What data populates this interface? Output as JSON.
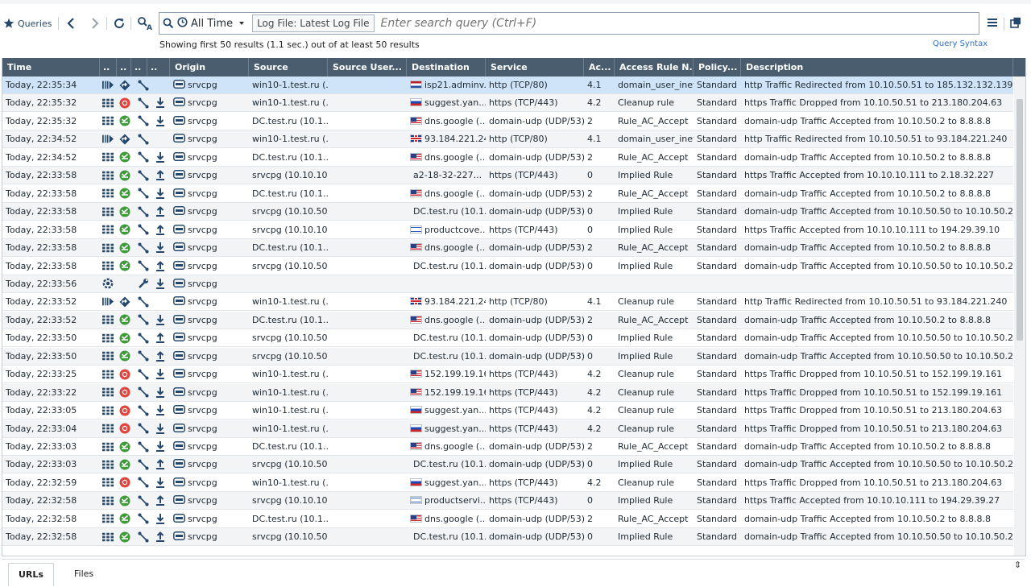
{
  "toolbar": {
    "queries_label": "Queries",
    "time_filter": "All Time",
    "log_file_chip": "Log File: Latest Log File",
    "search_placeholder": "Enter search query (Ctrl+F)"
  },
  "status": {
    "summary": "Showing first 50 results (1.1 sec.) out of at least 50 results",
    "query_syntax_link": "Query Syntax"
  },
  "columns": [
    "Time",
    "..",
    "..",
    "..",
    "..",
    "Origin",
    "Source",
    "Source User...",
    "Destination",
    "Service",
    "Ac...",
    "Access Rule N...",
    "Policy...",
    "Description"
  ],
  "rows": [
    {
      "time": "Today, 22:35:34",
      "icons": [
        "vendor",
        "redirect",
        "conn",
        ""
      ],
      "origin": "srvcpg",
      "source": "win10-1.test.ru (...",
      "dest_flag": "nl",
      "destination": "isp21.adminv...",
      "service": "http (TCP/80)",
      "ac": "4.1",
      "rule": "domain_user_inet",
      "policy": "Standard",
      "description": "http Traffic Redirected from 10.10.50.51 to 185.132.132.139"
    },
    {
      "time": "Today, 22:35:32",
      "icons": [
        "grid",
        "drop",
        "conn",
        "down"
      ],
      "origin": "srvcpg",
      "source": "win10-1.test.ru (...",
      "dest_flag": "ru",
      "destination": "suggest.yan...",
      "service": "https (TCP/443)",
      "ac": "4.2",
      "rule": "Cleanup rule",
      "policy": "Standard",
      "description": "https Traffic Dropped from 10.10.50.51 to 213.180.204.63"
    },
    {
      "time": "Today, 22:35:32",
      "icons": [
        "grid",
        "accept",
        "conn",
        "down"
      ],
      "origin": "srvcpg",
      "source": "DC.test.ru (10.1...",
      "dest_flag": "us",
      "destination": "dns.google (...",
      "service": "domain-udp (UDP/53)",
      "ac": "2",
      "rule": "Rule_AC_Accept",
      "policy": "Standard",
      "description": "domain-udp Traffic Accepted from 10.10.50.2 to 8.8.8.8"
    },
    {
      "time": "Today, 22:34:52",
      "icons": [
        "vendor",
        "redirect",
        "conn",
        ""
      ],
      "origin": "srvcpg",
      "source": "win10-1.test.ru (...",
      "dest_flag": "gb",
      "destination": "93.184.221.240",
      "service": "http (TCP/80)",
      "ac": "4.1",
      "rule": "domain_user_inet",
      "policy": "Standard",
      "description": "http Traffic Redirected from 10.10.50.51 to 93.184.221.240"
    },
    {
      "time": "Today, 22:34:52",
      "icons": [
        "grid",
        "accept",
        "conn",
        "down"
      ],
      "origin": "srvcpg",
      "source": "DC.test.ru (10.1...",
      "dest_flag": "us",
      "destination": "dns.google (...",
      "service": "domain-udp (UDP/53)",
      "ac": "2",
      "rule": "Rule_AC_Accept",
      "policy": "Standard",
      "description": "domain-udp Traffic Accepted from 10.10.50.2 to 8.8.8.8"
    },
    {
      "time": "Today, 22:33:58",
      "icons": [
        "grid",
        "accept",
        "conn",
        "up"
      ],
      "origin": "srvcpg",
      "source": "srvcpg (10.10.10....",
      "dest_flag": "",
      "destination": "a2-18-32-227...",
      "service": "https (TCP/443)",
      "ac": "0",
      "rule": "Implied Rule",
      "policy": "Standard",
      "description": "https Traffic Accepted from 10.10.10.111 to 2.18.32.227"
    },
    {
      "time": "Today, 22:33:58",
      "icons": [
        "grid",
        "accept",
        "conn",
        "down"
      ],
      "origin": "srvcpg",
      "source": "DC.test.ru (10.1...",
      "dest_flag": "us",
      "destination": "dns.google (...",
      "service": "domain-udp (UDP/53)",
      "ac": "2",
      "rule": "Rule_AC_Accept",
      "policy": "Standard",
      "description": "domain-udp Traffic Accepted from 10.10.50.2 to 8.8.8.8"
    },
    {
      "time": "Today, 22:33:58",
      "icons": [
        "grid",
        "accept",
        "conn",
        "up"
      ],
      "origin": "srvcpg",
      "source": "srvcpg (10.10.50....",
      "dest_flag": "",
      "destination": "DC.test.ru (10.1...",
      "service": "domain-udp (UDP/53)",
      "ac": "0",
      "rule": "Implied Rule",
      "policy": "Standard",
      "description": "domain-udp Traffic Accepted from 10.10.50.50 to 10.10.50.2"
    },
    {
      "time": "Today, 22:33:58",
      "icons": [
        "grid",
        "accept",
        "conn",
        "up"
      ],
      "origin": "srvcpg",
      "source": "srvcpg (10.10.10....",
      "dest_flag": "il",
      "destination": "productcove...",
      "service": "https (TCP/443)",
      "ac": "0",
      "rule": "Implied Rule",
      "policy": "Standard",
      "description": "https Traffic Accepted from 10.10.10.111 to 194.29.39.10"
    },
    {
      "time": "Today, 22:33:58",
      "icons": [
        "grid",
        "accept",
        "conn",
        "down"
      ],
      "origin": "srvcpg",
      "source": "DC.test.ru (10.1...",
      "dest_flag": "us",
      "destination": "dns.google (...",
      "service": "domain-udp (UDP/53)",
      "ac": "2",
      "rule": "Rule_AC_Accept",
      "policy": "Standard",
      "description": "domain-udp Traffic Accepted from 10.10.50.2 to 8.8.8.8"
    },
    {
      "time": "Today, 22:33:58",
      "icons": [
        "grid",
        "accept",
        "conn",
        "up"
      ],
      "origin": "srvcpg",
      "source": "srvcpg (10.10.50....",
      "dest_flag": "",
      "destination": "DC.test.ru (10.1...",
      "service": "domain-udp (UDP/53)",
      "ac": "0",
      "rule": "Implied Rule",
      "policy": "Standard",
      "description": "domain-udp Traffic Accepted from 10.10.50.50 to 10.10.50.2"
    },
    {
      "time": "Today, 22:33:56",
      "icons": [
        "gear",
        "",
        "wrench",
        "down"
      ],
      "origin": "srvcpg",
      "source": "",
      "dest_flag": "",
      "destination": "",
      "service": "",
      "ac": "",
      "rule": "",
      "policy": "",
      "description": ""
    },
    {
      "time": "Today, 22:33:52",
      "icons": [
        "vendor",
        "redirect",
        "conn",
        ""
      ],
      "origin": "srvcpg",
      "source": "win10-1.test.ru (...",
      "dest_flag": "gb",
      "destination": "93.184.221.240",
      "service": "http (TCP/80)",
      "ac": "4.1",
      "rule": "Cleanup rule",
      "policy": "Standard",
      "description": "http Traffic Redirected from 10.10.50.51 to 93.184.221.240"
    },
    {
      "time": "Today, 22:33:52",
      "icons": [
        "grid",
        "accept",
        "conn",
        "down"
      ],
      "origin": "srvcpg",
      "source": "DC.test.ru (10.1...",
      "dest_flag": "us",
      "destination": "dns.google (...",
      "service": "domain-udp (UDP/53)",
      "ac": "2",
      "rule": "Rule_AC_Accept",
      "policy": "Standard",
      "description": "domain-udp Traffic Accepted from 10.10.50.2 to 8.8.8.8"
    },
    {
      "time": "Today, 22:33:50",
      "icons": [
        "grid",
        "accept",
        "conn",
        "up"
      ],
      "origin": "srvcpg",
      "source": "srvcpg (10.10.50....",
      "dest_flag": "",
      "destination": "DC.test.ru (10.1...",
      "service": "domain-udp (UDP/53)",
      "ac": "0",
      "rule": "Implied Rule",
      "policy": "Standard",
      "description": "domain-udp Traffic Accepted from 10.10.50.50 to 10.10.50.2"
    },
    {
      "time": "Today, 22:33:50",
      "icons": [
        "grid",
        "accept",
        "conn",
        "up"
      ],
      "origin": "srvcpg",
      "source": "srvcpg (10.10.50....",
      "dest_flag": "",
      "destination": "DC.test.ru (10.1...",
      "service": "domain-udp (UDP/53)",
      "ac": "0",
      "rule": "Implied Rule",
      "policy": "Standard",
      "description": "domain-udp Traffic Accepted from 10.10.50.50 to 10.10.50.2"
    },
    {
      "time": "Today, 22:33:25",
      "icons": [
        "grid",
        "drop",
        "conn",
        "down"
      ],
      "origin": "srvcpg",
      "source": "win10-1.test.ru (...",
      "dest_flag": "us",
      "destination": "152.199.19.161",
      "service": "https (TCP/443)",
      "ac": "4.2",
      "rule": "Cleanup rule",
      "policy": "Standard",
      "description": "https Traffic Dropped from 10.10.50.51 to 152.199.19.161"
    },
    {
      "time": "Today, 22:33:22",
      "icons": [
        "grid",
        "drop",
        "conn",
        "down"
      ],
      "origin": "srvcpg",
      "source": "win10-1.test.ru (...",
      "dest_flag": "us",
      "destination": "152.199.19.161",
      "service": "https (TCP/443)",
      "ac": "4.2",
      "rule": "Cleanup rule",
      "policy": "Standard",
      "description": "https Traffic Dropped from 10.10.50.51 to 152.199.19.161"
    },
    {
      "time": "Today, 22:33:05",
      "icons": [
        "grid",
        "drop",
        "conn",
        "down"
      ],
      "origin": "srvcpg",
      "source": "win10-1.test.ru (...",
      "dest_flag": "ru",
      "destination": "suggest.yan...",
      "service": "https (TCP/443)",
      "ac": "4.2",
      "rule": "Cleanup rule",
      "policy": "Standard",
      "description": "https Traffic Dropped from 10.10.50.51 to 213.180.204.63"
    },
    {
      "time": "Today, 22:33:04",
      "icons": [
        "grid",
        "drop",
        "conn",
        "down"
      ],
      "origin": "srvcpg",
      "source": "win10-1.test.ru (...",
      "dest_flag": "ru",
      "destination": "suggest.yan...",
      "service": "https (TCP/443)",
      "ac": "4.2",
      "rule": "Cleanup rule",
      "policy": "Standard",
      "description": "https Traffic Dropped from 10.10.50.51 to 213.180.204.63"
    },
    {
      "time": "Today, 22:33:03",
      "icons": [
        "grid",
        "accept",
        "conn",
        "down"
      ],
      "origin": "srvcpg",
      "source": "DC.test.ru (10.1...",
      "dest_flag": "us",
      "destination": "dns.google (...",
      "service": "domain-udp (UDP/53)",
      "ac": "2",
      "rule": "Rule_AC_Accept",
      "policy": "Standard",
      "description": "domain-udp Traffic Accepted from 10.10.50.2 to 8.8.8.8"
    },
    {
      "time": "Today, 22:33:03",
      "icons": [
        "grid",
        "accept",
        "conn",
        "up"
      ],
      "origin": "srvcpg",
      "source": "srvcpg (10.10.50....",
      "dest_flag": "",
      "destination": "DC.test.ru (10.1...",
      "service": "domain-udp (UDP/53)",
      "ac": "0",
      "rule": "Implied Rule",
      "policy": "Standard",
      "description": "domain-udp Traffic Accepted from 10.10.50.50 to 10.10.50.2"
    },
    {
      "time": "Today, 22:32:59",
      "icons": [
        "grid",
        "drop",
        "conn",
        "down"
      ],
      "origin": "srvcpg",
      "source": "win10-1.test.ru (...",
      "dest_flag": "ru",
      "destination": "suggest.yan...",
      "service": "https (TCP/443)",
      "ac": "4.2",
      "rule": "Cleanup rule",
      "policy": "Standard",
      "description": "https Traffic Dropped from 10.10.50.51 to 213.180.204.63"
    },
    {
      "time": "Today, 22:32:58",
      "icons": [
        "grid",
        "accept",
        "conn",
        "up"
      ],
      "origin": "srvcpg",
      "source": "srvcpg (10.10.10....",
      "dest_flag": "il",
      "destination": "productservi...",
      "service": "https (TCP/443)",
      "ac": "0",
      "rule": "Implied Rule",
      "policy": "Standard",
      "description": "https Traffic Accepted from 10.10.10.111 to 194.29.39.27"
    },
    {
      "time": "Today, 22:32:58",
      "icons": [
        "grid",
        "accept",
        "conn",
        "down"
      ],
      "origin": "srvcpg",
      "source": "DC.test.ru (10.1...",
      "dest_flag": "us",
      "destination": "dns.google (...",
      "service": "domain-udp (UDP/53)",
      "ac": "2",
      "rule": "Rule_AC_Accept",
      "policy": "Standard",
      "description": "domain-udp Traffic Accepted from 10.10.50.2 to 8.8.8.8"
    },
    {
      "time": "Today, 22:32:58",
      "icons": [
        "grid",
        "accept",
        "conn",
        "up"
      ],
      "origin": "srvcpg",
      "source": "srvcpg (10.10.50....",
      "dest_flag": "",
      "destination": "DC.test.ru (10.1...",
      "service": "domain-udp (UDP/53)",
      "ac": "0",
      "rule": "Implied Rule",
      "policy": "Standard",
      "description": "domain-udp Traffic Accepted from 10.10.50.50 to 10.10.50.2"
    }
  ],
  "bottom_tabs": [
    "URLs",
    "Files"
  ],
  "colors": {
    "header_bg": "#4a5d6e",
    "selected_row": "#cfe4f8",
    "accent_icon": "#24476b",
    "accept_green": "#3f9a3a",
    "drop_red": "#e0463f"
  }
}
